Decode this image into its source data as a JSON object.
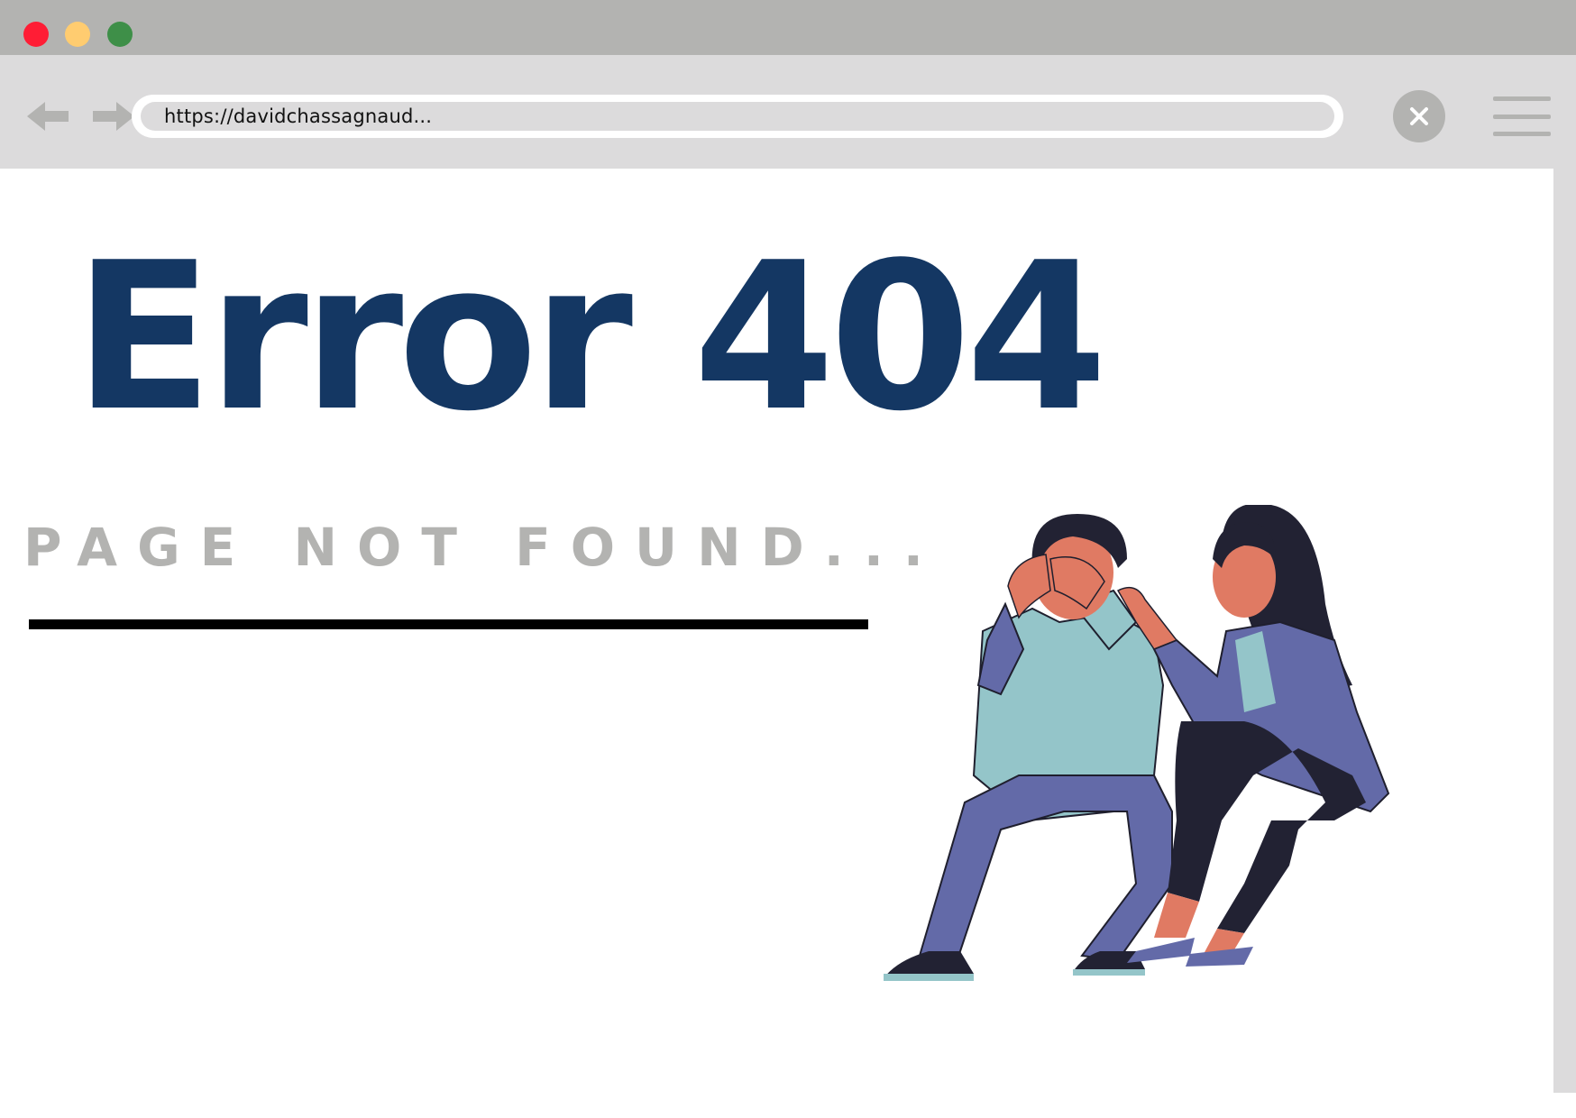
{
  "window": {
    "controls": [
      {
        "name": "close",
        "color": "#ff1d35"
      },
      {
        "name": "minimize",
        "color": "#ffcc70"
      },
      {
        "name": "zoom",
        "color": "#3e8f48"
      }
    ]
  },
  "toolbar": {
    "back_icon": "arrow-left-icon",
    "forward_icon": "arrow-right-icon",
    "url": "https://davidchassagnaud...",
    "close_icon": "close-icon",
    "menu_icon": "hamburger-menu-icon"
  },
  "page": {
    "title": "Error 404",
    "subtitle": "PAGE NOT FOUND...",
    "illustration": "two-people-sitting-consoling"
  },
  "colors": {
    "title": "#143763",
    "subtitle": "#b3b3b1",
    "chrome_dark": "#b3b3b1",
    "chrome_light": "#dcdbdc"
  }
}
